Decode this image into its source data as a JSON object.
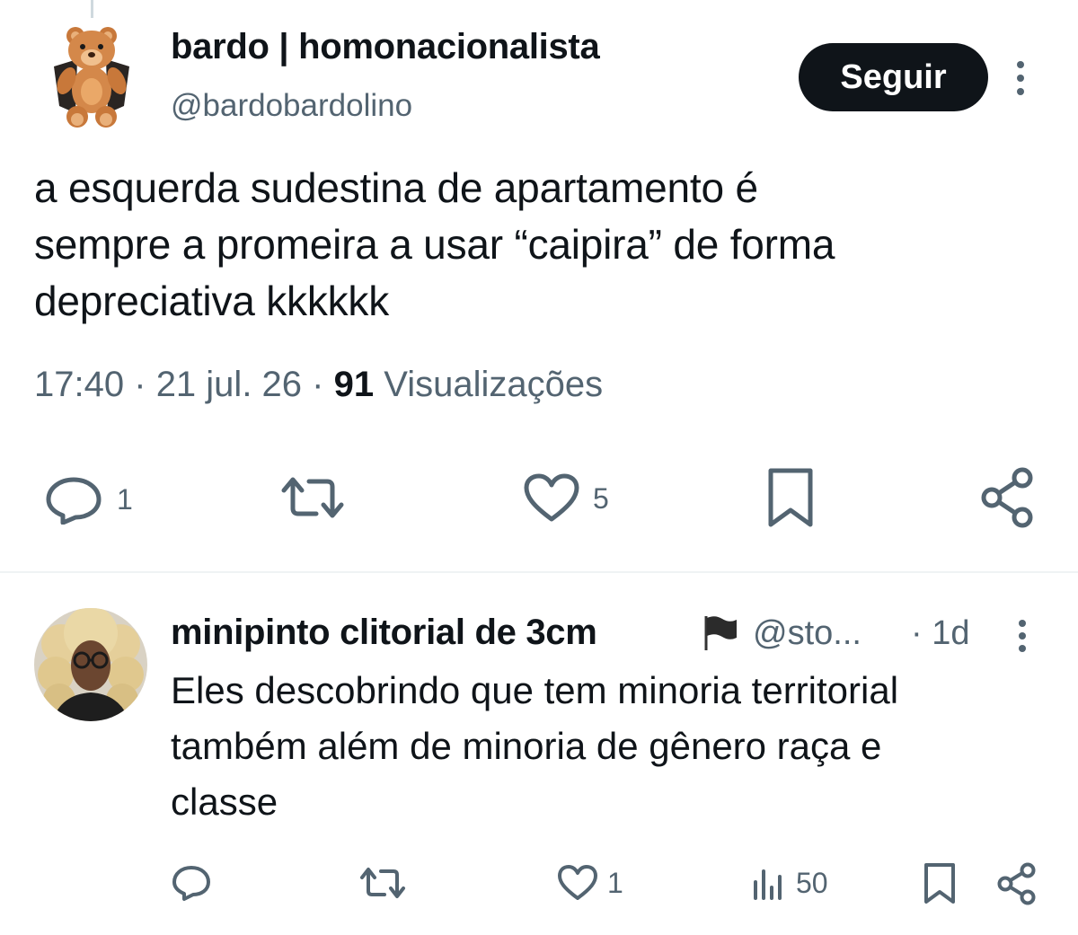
{
  "tweet": {
    "author_name": "bardo | homonacionalista",
    "author_handle": "@bardobardolino",
    "follow_label": "Seguir",
    "text_lines": [
      "a esquerda sudestina de apartamento é",
      "sempre a promeira a usar “caipira” de forma",
      "depreciativa kkkkkk"
    ],
    "time": "17:40",
    "separator": "·",
    "date": "21 jul. 26",
    "views_count": "91",
    "views_label": "Visualizações",
    "actions": {
      "reply_count": "1",
      "like_count": "5"
    },
    "avatar_icon": "teddy-bear-avatar"
  },
  "reply": {
    "author_name": "minipinto clitorial de 3cm",
    "flag_emoji": "black-flag-icon",
    "author_handle": "@sto...",
    "time": "· 1d",
    "text_lines": [
      "Eles descobrindo que tem minoria territorial",
      "também além de minoria de gênero raça e",
      "classe"
    ],
    "actions": {
      "like_count": "1",
      "views_count": "50"
    },
    "avatar_icon": "person-photo-avatar"
  },
  "colors": {
    "text_primary": "#0f1419",
    "text_secondary": "#536471",
    "divider": "#eff3f4",
    "button_bg": "#0f1419"
  }
}
